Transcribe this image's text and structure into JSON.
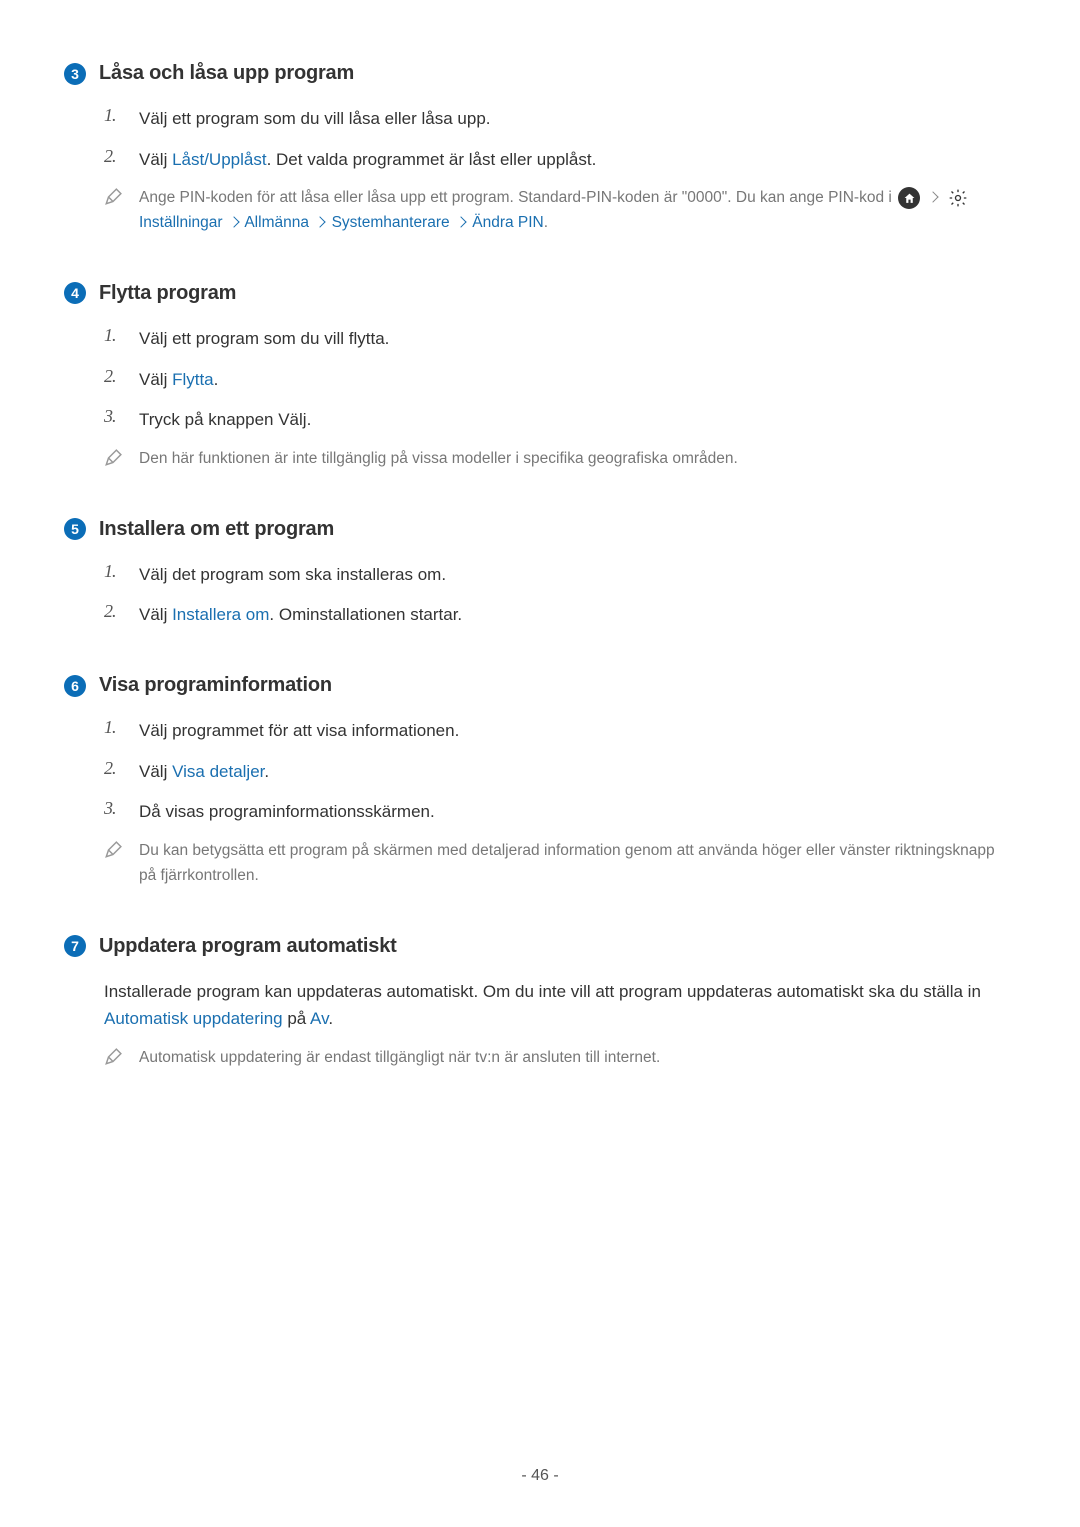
{
  "sections": [
    {
      "num": "3",
      "title": "Låsa och låsa upp program",
      "items": [
        {
          "n": "1.",
          "text": "Välj ett program som du vill låsa eller låsa upp."
        },
        {
          "n": "2.",
          "prefix": "Välj ",
          "link": "Låst/Upplåst",
          "suffix": ". Det valda programmet är låst eller upplåst."
        }
      ],
      "note_prefix": "Ange PIN-koden för att låsa eller låsa upp ett program. Standard-PIN-koden är \"0000\". Du kan ange PIN-kod i ",
      "breadcrumb": [
        "Inställningar",
        "Allmänna",
        "Systemhanterare",
        "Ändra PIN"
      ]
    },
    {
      "num": "4",
      "title": "Flytta program",
      "items": [
        {
          "n": "1.",
          "text": "Välj ett program som du vill flytta."
        },
        {
          "n": "2.",
          "prefix": "Välj ",
          "link": "Flytta",
          "suffix": "."
        },
        {
          "n": "3.",
          "text": "Tryck på knappen Välj."
        }
      ],
      "note": "Den här funktionen är inte tillgänglig på vissa modeller i specifika geografiska områden."
    },
    {
      "num": "5",
      "title": "Installera om ett program",
      "items": [
        {
          "n": "1.",
          "text": "Välj det program som ska installeras om."
        },
        {
          "n": "2.",
          "prefix": "Välj ",
          "link": "Installera om",
          "suffix": ". Ominstallationen startar."
        }
      ]
    },
    {
      "num": "6",
      "title": "Visa programinformation",
      "items": [
        {
          "n": "1.",
          "text": "Välj programmet för att visa informationen."
        },
        {
          "n": "2.",
          "prefix": "Välj ",
          "link": "Visa detaljer",
          "suffix": "."
        },
        {
          "n": "3.",
          "text": "Då visas programinformationsskärmen."
        }
      ],
      "note": "Du kan betygsätta ett program på skärmen med detaljerad information genom att använda höger eller vänster riktningsknapp på fjärrkontrollen."
    },
    {
      "num": "7",
      "title": "Uppdatera program automatiskt",
      "para_prefix": "Installerade program kan uppdateras automatiskt. Om du inte vill att program uppdateras automatiskt ska du ställa in ",
      "para_link1": "Automatisk uppdatering",
      "para_mid": " på ",
      "para_link2": "Av",
      "para_suffix": ".",
      "note": "Automatisk uppdatering är endast tillgängligt när tv:n är ansluten till internet."
    }
  ],
  "page_number": "- 46 -"
}
